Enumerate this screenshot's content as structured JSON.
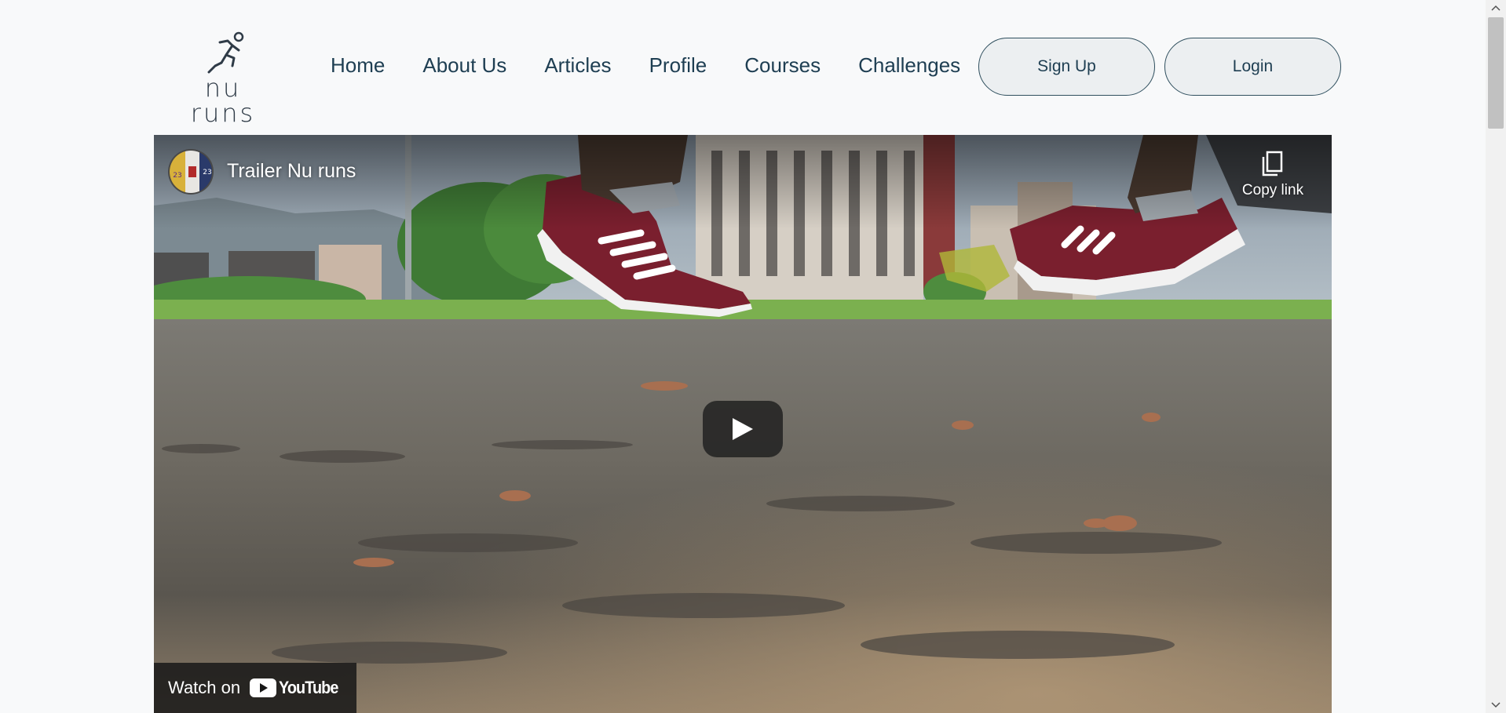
{
  "brand": {
    "name": "nu runs",
    "logo_icon": "runner-icon"
  },
  "nav": {
    "items": [
      "Home",
      "About Us",
      "Articles",
      "Profile",
      "Courses",
      "Challenges"
    ]
  },
  "auth": {
    "signup_label": "Sign Up",
    "login_label": "Login"
  },
  "video": {
    "title": "Trailer Nu runs",
    "copy_link_label": "Copy link",
    "watch_on_label": "Watch on",
    "platform_label": "YouTube",
    "icons": {
      "copy": "copy-icon",
      "play": "play-icon",
      "avatar": "channel-avatar"
    }
  },
  "colors": {
    "nav_text": "#1e3e52",
    "button_border": "#2f4f5e",
    "button_bg": "#eceff1",
    "page_bg": "#f8f9fa",
    "youtube_red": "#ff0000"
  }
}
